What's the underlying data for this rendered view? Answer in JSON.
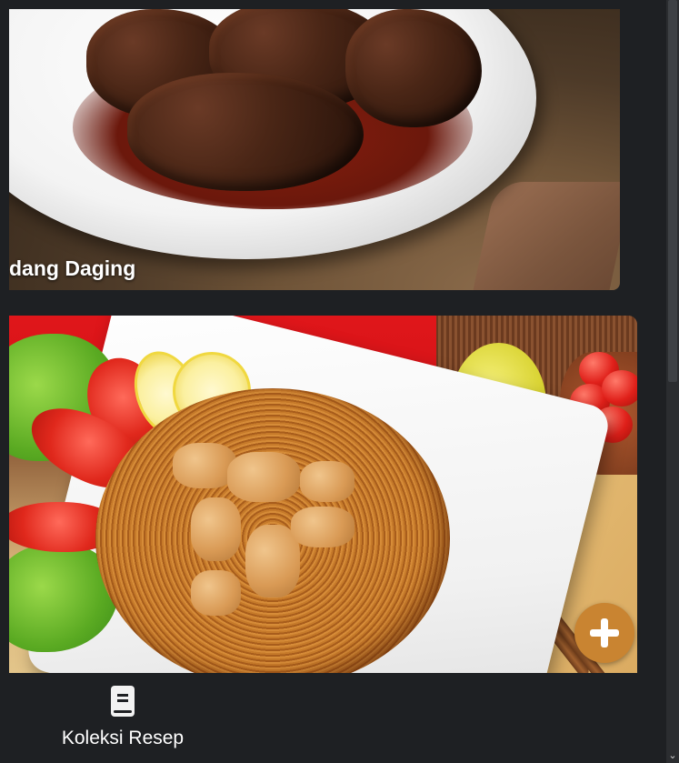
{
  "recipes": [
    {
      "title": "dang Daging"
    },
    {
      "title": ""
    }
  ],
  "fab": {
    "icon": "plus-icon"
  },
  "bottom_nav": {
    "items": [
      {
        "label": "Koleksi Resep",
        "icon": "book-icon"
      }
    ]
  },
  "colors": {
    "background": "#1e2023",
    "fab": "#c98431",
    "text": "#ffffff"
  }
}
